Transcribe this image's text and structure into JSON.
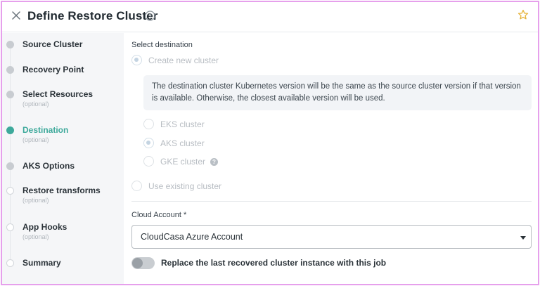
{
  "header": {
    "title": "Define Restore Cluster",
    "close_icon": "close-icon",
    "help_icon": "help-circle-icon",
    "favorite_icon": "star-outline-icon"
  },
  "sidebar": {
    "steps": [
      {
        "label": "Source Cluster",
        "sub": "",
        "state": "done"
      },
      {
        "label": "Recovery Point",
        "sub": "",
        "state": "done"
      },
      {
        "label": "Select Resources",
        "sub": "(optional)",
        "state": "done"
      },
      {
        "label": "Destination",
        "sub": "(optional)",
        "state": "active"
      },
      {
        "label": "AKS Options",
        "sub": "",
        "state": "done"
      },
      {
        "label": "Restore transforms",
        "sub": "(optional)",
        "state": "pending"
      },
      {
        "label": "App Hooks",
        "sub": "(optional)",
        "state": "pending"
      },
      {
        "label": "Summary",
        "sub": "",
        "state": "pending"
      }
    ]
  },
  "main": {
    "select_destination_label": "Select destination",
    "create_new": "Create new cluster",
    "info_text": "The destination cluster Kubernetes version will be the same as the source cluster version if that version is available. Otherwise, the closest available version will be used.",
    "cluster_types": [
      {
        "label": "EKS cluster",
        "selected": false
      },
      {
        "label": "AKS cluster",
        "selected": true
      },
      {
        "label": "GKE cluster",
        "selected": false
      }
    ],
    "use_existing": "Use existing cluster",
    "cloud_account_label": "Cloud Account *",
    "cloud_account_value": "CloudCasa Azure Account",
    "replace_toggle_label": "Replace the last recovered cluster instance with this job",
    "replace_toggle_on": false
  },
  "colors": {
    "accent": "#3da99b",
    "frame_border": "#e6a0ec",
    "star": "#e6b43c"
  }
}
